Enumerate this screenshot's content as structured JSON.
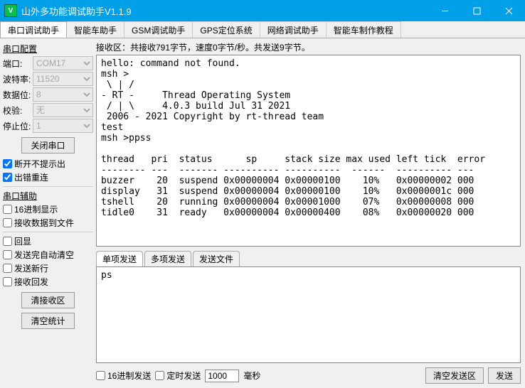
{
  "window": {
    "title": "山外多功能调试助手V1.1.9",
    "icon_letter": "V"
  },
  "main_tabs": [
    "串口调试助手",
    "智能车助手",
    "GSM调试助手",
    "GPS定位系统",
    "网络调试助手",
    "智能车制作教程"
  ],
  "serial_config": {
    "title": "串口配置",
    "rows": [
      {
        "label": "端口:",
        "value": "COM17"
      },
      {
        "label": "波特率:",
        "value": "11520"
      },
      {
        "label": "数据位:",
        "value": "8"
      },
      {
        "label": "校验:",
        "value": "无"
      },
      {
        "label": "停止位:",
        "value": "1"
      }
    ],
    "close_btn": "关闭串口",
    "chk_disconnect": "断开不提示出",
    "chk_error": "出错重连"
  },
  "serial_aux": {
    "title": "串口辅助",
    "chk_hex_disp": "16进制显示",
    "chk_recv_file": "接收数据到文件"
  },
  "misc": {
    "chk_echo": "回显",
    "chk_auto_clear": "发送完自动清空",
    "chk_send_newline": "发送新行",
    "chk_recv_echo": "接收回发",
    "btn_clear_rx": "清接收区",
    "btn_clear_stats": "清空统计"
  },
  "rx_info": "接收区：共接收791字节，速度0字节/秒。共发送9字节。",
  "rx_text": "hello: command not found.\nmsh >\n \\ | /\n- RT -     Thread Operating System\n / | \\     4.0.3 build Jul 31 2021\n 2006 - 2021 Copyright by rt-thread team\ntest\nmsh >ppss\n\nthread   pri  status      sp     stack size max used left tick  error\n-------- ---  ------- ---------- ----------  ------  ---------- ---\nbuzzer    20  suspend 0x00000004 0x00000100    10%   0x00000002 000\ndisplay   31  suspend 0x00000004 0x00000100    10%   0x0000001c 000\ntshell    20  running 0x00000004 0x00001000    07%   0x00000008 000\ntidle0    31  ready   0x00000004 0x00000400    08%   0x00000020 000",
  "send_tabs": [
    "单项发送",
    "多项发送",
    "发送文件"
  ],
  "tx_text": "ps",
  "bottom": {
    "chk_hex_send": "16进制发送",
    "chk_timed": "定时发送",
    "interval": "1000",
    "unit": "毫秒",
    "btn_clear_tx": "清空发送区",
    "btn_send": "发送"
  }
}
